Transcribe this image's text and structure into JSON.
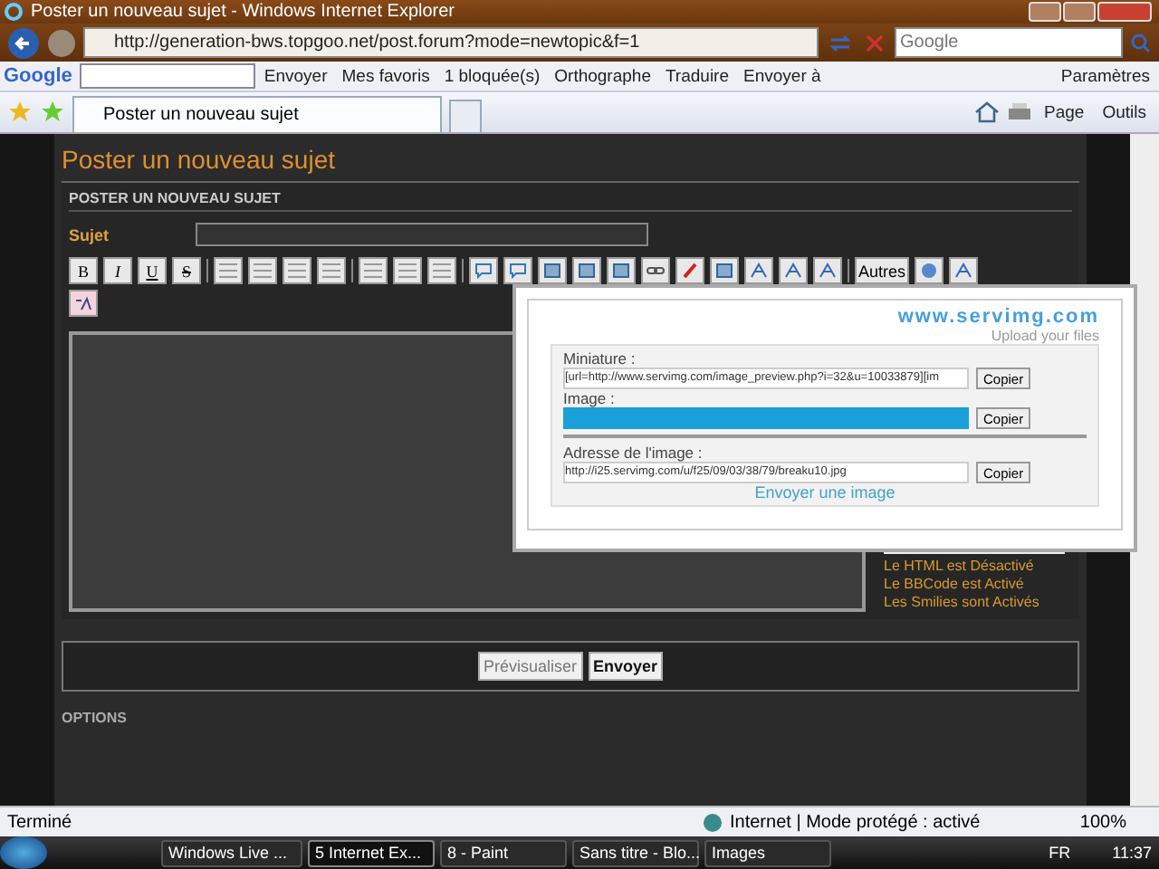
{
  "window": {
    "title": "Poster un nouveau sujet - Windows Internet Explorer"
  },
  "address_bar": {
    "url": "http://generation-bws.topgoo.net/post.forum?mode=newtopic&f=1"
  },
  "search": {
    "placeholder": "Google"
  },
  "google_toolbar": {
    "logo": "Google",
    "send": "Envoyer",
    "items": [
      "Mes favoris",
      "1 bloquée(s)",
      "Orthographe",
      "Traduire",
      "Envoyer à"
    ],
    "settings": "Paramètres"
  },
  "tabs": [
    {
      "label": "Poster un nouveau sujet",
      "selected": true
    }
  ],
  "command_bar": [
    "Page",
    "Outils"
  ],
  "page": {
    "heading": "Poster un nouveau sujet",
    "section_title": "POSTER UN NOUVEAU SUJET",
    "subject_label": "Sujet",
    "format_buttons": [
      "B",
      "I",
      "U",
      "S"
    ],
    "more_button": "Autres",
    "status_lines": [
      "Le HTML est Désactivé",
      "Le BBCode est Activé",
      "Les Smilies sont Activés"
    ],
    "buttons": [
      {
        "label": "Prévisualiser",
        "kind": "secondary"
      },
      {
        "label": "Envoyer",
        "kind": "primary"
      }
    ],
    "options_title": "OPTIONS"
  },
  "upload_popup": {
    "logo": "www.servimg.com",
    "tagline": "Upload your files",
    "fields": [
      {
        "label": "Miniature :",
        "value": "[url=http://www.servimg.com/image_preview.php?i=32&u=10033879][im",
        "button": "Copier",
        "redacted": false
      },
      {
        "label": "Image :",
        "button": "Copier",
        "redacted": true
      },
      {
        "label": "Adresse de l'image :",
        "value": "http://i25.servimg.com/u/f25/09/03/38/79/breaku10.jpg",
        "button": "Copier",
        "redacted": false
      }
    ],
    "link": "Envoyer une image"
  },
  "status_bar": {
    "text": "Terminé",
    "zone": "Internet | Mode protégé : activé",
    "zoom": "100%"
  },
  "taskbar": {
    "items": [
      {
        "label": "Windows Live ...",
        "selected": false
      },
      {
        "label": "5 Internet Ex...",
        "selected": true
      },
      {
        "label": "8 - Paint",
        "selected": false
      },
      {
        "label": "Sans titre - Blo...",
        "selected": false
      },
      {
        "label": "Images",
        "selected": false
      }
    ],
    "language": "FR",
    "clock": "11:37"
  }
}
